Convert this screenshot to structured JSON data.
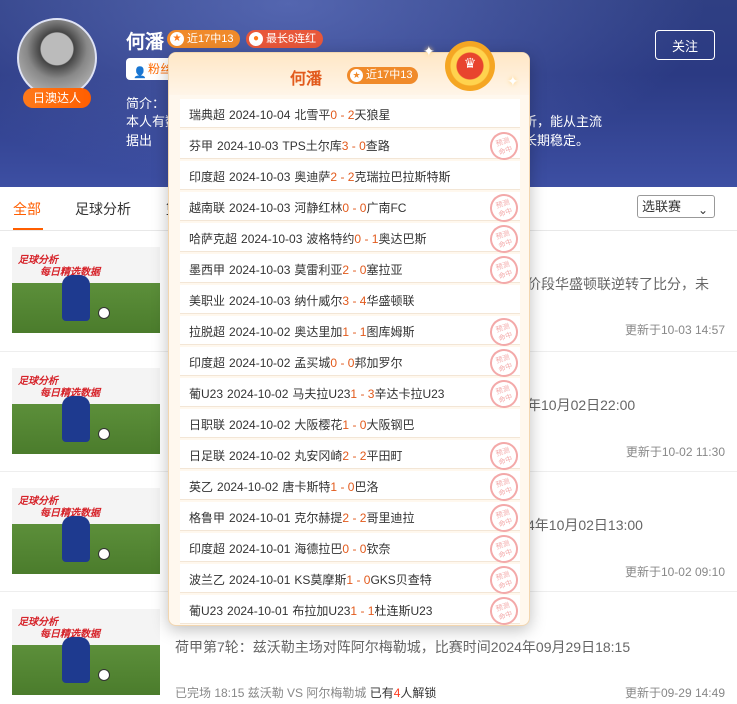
{
  "profile": {
    "name": "何潘",
    "badge": "日澳达人",
    "tag_recent": "近17中13",
    "tag_streak": "最长8连红",
    "fans_label": "粉丝",
    "intro_label": "简介：",
    "intro_text": "本人有数据出",
    "intro_right_1": "析，能从主流",
    "intro_right_2": "长期稳定。",
    "follow_label": "关注"
  },
  "tabs": {
    "all": "全部",
    "football": "足球分析",
    "other": "篮"
  },
  "league_select": "选联赛",
  "articles": [
    {
      "thumb_title_1": "足球分析",
      "thumb_title_2": "每日精选数据",
      "title_visible": "价段华盛顿联逆转了比分，未",
      "meta": "",
      "time": "更新于10-03 14:57"
    },
    {
      "thumb_title_1": "足球分析",
      "thumb_title_2": "每日精选数据",
      "title_visible": "年10月02日22:00",
      "meta": "",
      "time": "更新于10-02 11:30"
    },
    {
      "thumb_title_1": "足球分析",
      "thumb_title_2": "每日精选数据",
      "title_visible": "4年10月02日13:00",
      "meta": "",
      "time": "更新于10-02 09:10"
    },
    {
      "thumb_title_1": "足球分析",
      "thumb_title_2": "每日精选数据",
      "title_visible": "荷甲第7轮：兹沃勒主场对阵阿尔梅勒城，比赛时间2024年09月29日18:15",
      "meta_prefix": "已完场 18:15 兹沃勒 VS 阿尔梅勒城",
      "meta_unlock_a": "已有",
      "meta_unlock_n": "4",
      "meta_unlock_b": "人解锁",
      "time": "更新于09-29 14:49"
    }
  ],
  "popup": {
    "name": "何潘",
    "tag": "近17中13",
    "stamp_text_1": "预测",
    "stamp_text_2": "命中",
    "matches": [
      {
        "league": "瑞典超",
        "date": "2024-10-04",
        "home": "北雪平",
        "hs": "0",
        "as": "2",
        "away": "天狼星",
        "hit": false
      },
      {
        "league": "芬甲",
        "date": "2024-10-03",
        "home": "TPS土尔库",
        "hs": "3",
        "as": "0",
        "away": "查路",
        "hit": true
      },
      {
        "league": "印度超",
        "date": "2024-10-03",
        "home": "奥迪萨",
        "hs": "2",
        "as": "2",
        "away": "克瑞拉巴拉斯特斯",
        "hit": false
      },
      {
        "league": "越南联",
        "date": "2024-10-03",
        "home": "河静红林",
        "hs": "0",
        "as": "0",
        "away": "广南FC",
        "hit": true
      },
      {
        "league": "哈萨克超",
        "date": "2024-10-03",
        "home": "波格特约",
        "hs": "0",
        "as": "1",
        "away": "奥达巴斯",
        "hit": true
      },
      {
        "league": "墨西甲",
        "date": "2024-10-03",
        "home": "莫雷利亚",
        "hs": "2",
        "as": "0",
        "away": "塞拉亚",
        "hit": true
      },
      {
        "league": "美职业",
        "date": "2024-10-03",
        "home": "纳什威尔",
        "hs": "3",
        "as": "4",
        "away": "华盛顿联",
        "hit": false
      },
      {
        "league": "拉脱超",
        "date": "2024-10-02",
        "home": "奥达里加",
        "hs": "1",
        "as": "1",
        "away": "图库姆斯",
        "hit": true
      },
      {
        "league": "印度超",
        "date": "2024-10-02",
        "home": "孟买城",
        "hs": "0",
        "as": "0",
        "away": "邦加罗尔",
        "hit": true
      },
      {
        "league": "葡U23",
        "date": "2024-10-02",
        "home": "马夫拉U23",
        "hs": "1",
        "as": "3",
        "away": "辛达卡拉U23",
        "hit": true
      },
      {
        "league": "日职联",
        "date": "2024-10-02",
        "home": "大阪樱花",
        "hs": "1",
        "as": "0",
        "away": "大阪钢巴",
        "hit": false
      },
      {
        "league": "日足联",
        "date": "2024-10-02",
        "home": "丸安冈崎",
        "hs": "2",
        "as": "2",
        "away": "平田町",
        "hit": true
      },
      {
        "league": "英乙",
        "date": "2024-10-02",
        "home": "唐卡斯特",
        "hs": "1",
        "as": "0",
        "away": "巴洛",
        "hit": true
      },
      {
        "league": "格鲁甲",
        "date": "2024-10-01",
        "home": "克尔赫提",
        "hs": "2",
        "as": "2",
        "away": "哥里迪拉",
        "hit": true
      },
      {
        "league": "印度超",
        "date": "2024-10-01",
        "home": "海德拉巴",
        "hs": "0",
        "as": "0",
        "away": "钦奈",
        "hit": true
      },
      {
        "league": "波兰乙",
        "date": "2024-10-01",
        "home": "KS莫摩斯",
        "hs": "1",
        "as": "0",
        "away": "GKS贝查特",
        "hit": true
      },
      {
        "league": "葡U23",
        "date": "2024-10-01",
        "home": "布拉加U23",
        "hs": "1",
        "as": "1",
        "away": "杜连斯U23",
        "hit": true
      }
    ]
  }
}
